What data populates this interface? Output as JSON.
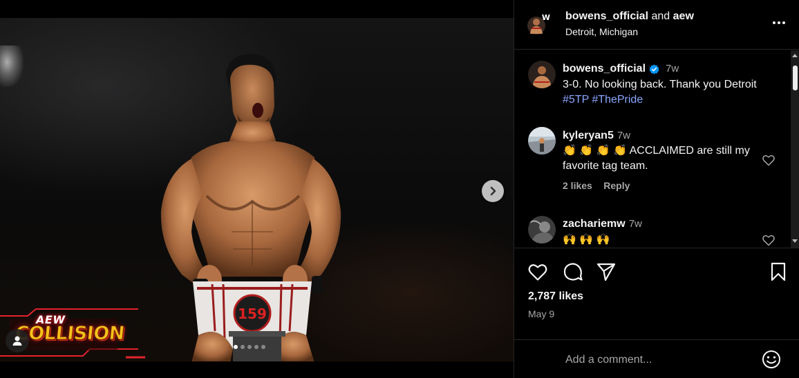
{
  "media": {
    "overlay_logo_top": "AEW",
    "overlay_logo_main": "COLLISION",
    "carousel_total": 5,
    "carousel_active": 1
  },
  "header": {
    "username": "bowens_official",
    "connector": "and",
    "collaborator": "aew",
    "location": "Detroit, Michigan"
  },
  "caption": {
    "username": "bowens_official",
    "time": "7w",
    "text": "3-0. No looking back. Thank you Detroit",
    "hashtags": [
      "#5TP",
      "#ThePride"
    ]
  },
  "comments": [
    {
      "username": "kyleryan5",
      "time": "7w",
      "emoji": "👏 👏 👏 👏",
      "text": "ACCLAIMED are still my favorite tag team.",
      "likes": "2 likes",
      "reply": "Reply"
    },
    {
      "username": "zachariemw",
      "time": "7w",
      "emoji": "🙌 🙌 🙌",
      "text": ""
    }
  ],
  "actions": {
    "likes": "2,787 likes",
    "date": "May 9"
  },
  "add_comment": {
    "placeholder": "Add a comment..."
  },
  "colors": {
    "background": "#000000",
    "text": "#f5f5f5",
    "muted": "#a8a8a8",
    "hashtag": "#8aa8ff",
    "verified": "#0095f6",
    "divider": "#262626"
  },
  "icons": [
    "chevron-right-icon",
    "user-icon",
    "more-icon",
    "verified-icon",
    "heart-icon",
    "comment-icon",
    "share-icon",
    "bookmark-icon",
    "emoji-icon"
  ]
}
